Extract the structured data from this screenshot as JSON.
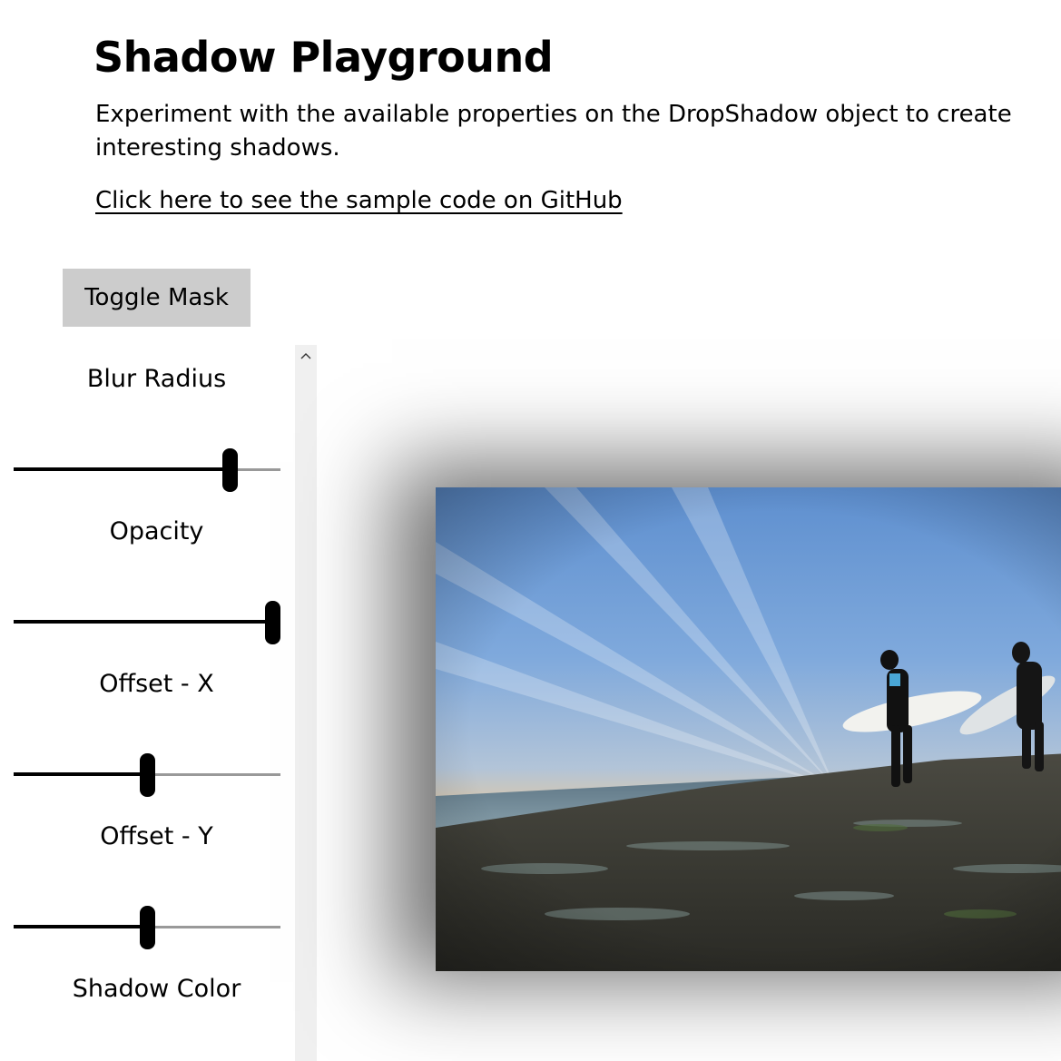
{
  "header": {
    "title": "Shadow Playground",
    "description": "Experiment with the available properties on the DropShadow object to create interesting shadows.",
    "github_link": "Click here to see the sample code on GitHub"
  },
  "toolbar": {
    "toggle_mask_label": "Toggle Mask"
  },
  "controls": [
    {
      "label": "Blur Radius",
      "value_fraction": 0.81
    },
    {
      "label": "Opacity",
      "value_fraction": 0.97
    },
    {
      "label": "Offset - X",
      "value_fraction": 0.5
    },
    {
      "label": "Offset - Y",
      "value_fraction": 0.5
    }
  ],
  "shadow_color_label": "Shadow Color",
  "colors": {
    "toggle_bg": "#cccccc",
    "scrollbar_bg": "#f0f0f0"
  }
}
